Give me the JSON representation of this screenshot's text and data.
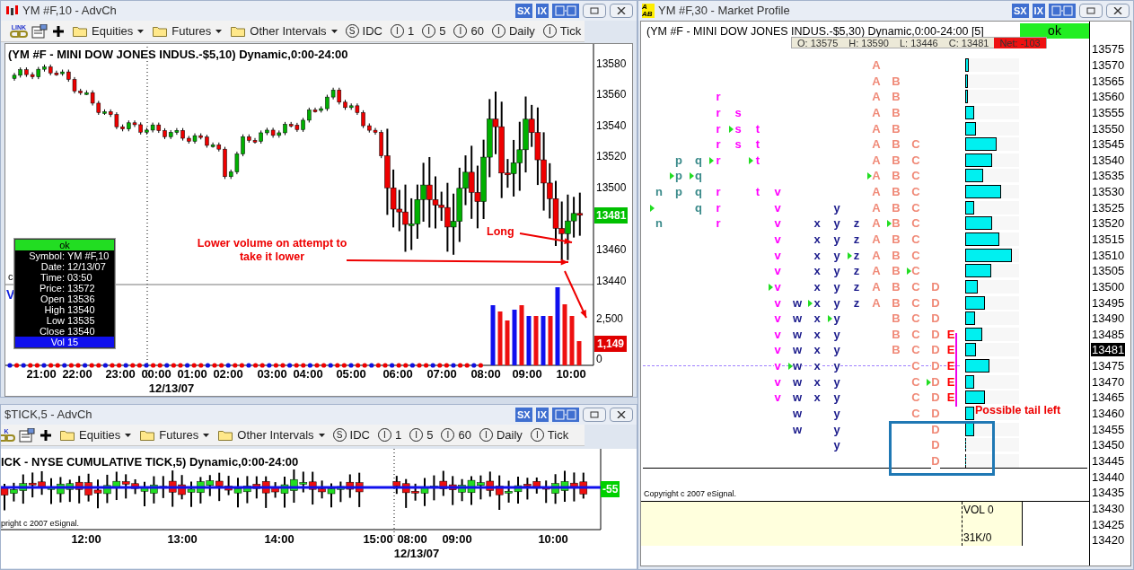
{
  "chart_window": {
    "title": "YM #F,10 - AdvCh",
    "title_buttons": [
      "SX",
      "IX"
    ],
    "toolbar": {
      "link_label": "LINK",
      "items": [
        {
          "kind": "folder",
          "label": "Equities"
        },
        {
          "kind": "folder",
          "label": "Futures"
        },
        {
          "kind": "folder",
          "label": "Other Intervals"
        },
        {
          "kind": "interval",
          "badge": "S",
          "label": "IDC"
        },
        {
          "kind": "interval",
          "badge": "I",
          "label": "1"
        },
        {
          "kind": "interval",
          "badge": "I",
          "label": "5"
        },
        {
          "kind": "interval",
          "badge": "I",
          "label": "60"
        },
        {
          "kind": "interval",
          "badge": "I",
          "label": "Daily"
        },
        {
          "kind": "interval",
          "badge": "I",
          "label": "Tick"
        }
      ]
    },
    "chart_title": "(YM #F - MINI DOW JONES INDUS.-$5,10) Dynamic,0:00-24:00",
    "price_labels": [
      "13580",
      "13560",
      "13540",
      "13520",
      "13500",
      "13460",
      "13440"
    ],
    "last_price": "13481",
    "volume_labels": [
      "2,500",
      "0"
    ],
    "last_volume": "1,149",
    "time_labels": [
      "21:00",
      "22:00",
      "23:00",
      "00:00",
      "01:00",
      "02:00",
      "03:00",
      "04:00",
      "05:00",
      "06:00",
      "07:00",
      "08:00",
      "09:00",
      "10:00"
    ],
    "date_label": "12/13/07",
    "edge_labels": [
      "c",
      "V"
    ],
    "data_window": {
      "status": "ok",
      "rows": [
        {
          "label": "Symbol:",
          "value": "YM #F,10",
          "selected": false
        },
        {
          "label": "Date:",
          "value": "12/13/07",
          "selected": false
        },
        {
          "label": "Time:",
          "value": "03:50",
          "selected": false
        },
        {
          "label": "Price:",
          "value": "13572",
          "selected": false
        },
        {
          "label": "Open",
          "value": "13536",
          "selected": false
        },
        {
          "label": "High",
          "value": "13540",
          "selected": false
        },
        {
          "label": "Low",
          "value": "13535",
          "selected": false
        },
        {
          "label": "Close",
          "value": "13540",
          "selected": false
        },
        {
          "label": "Vol",
          "value": "15",
          "selected": true
        }
      ]
    },
    "annotations": [
      "Lower volume on attempt to take it lower",
      "Long"
    ]
  },
  "tick_window": {
    "title": "$TICK,5 - AdvCh",
    "title_buttons": [
      "SX",
      "IX"
    ],
    "toolbar": {
      "link_label": "K",
      "items": [
        {
          "kind": "folder",
          "label": "Equities"
        },
        {
          "kind": "folder",
          "label": "Futures"
        },
        {
          "kind": "folder",
          "label": "Other Intervals"
        },
        {
          "kind": "interval",
          "badge": "S",
          "label": "IDC"
        },
        {
          "kind": "interval",
          "badge": "I",
          "label": "1"
        },
        {
          "kind": "interval",
          "badge": "I",
          "label": "5"
        },
        {
          "kind": "interval",
          "badge": "I",
          "label": "60"
        },
        {
          "kind": "interval",
          "badge": "I",
          "label": "Daily"
        },
        {
          "kind": "interval",
          "badge": "I",
          "label": "Tick"
        }
      ]
    },
    "chart_title": "ICK - NYSE CUMULATIVE TICK,5) Dynamic,0:00-24:00",
    "copyright": "pright c 2007 eSignal.",
    "last_value": "-55",
    "time_labels": [
      "12:00",
      "13:00",
      "14:00",
      "15:00",
      "08:00",
      "09:00",
      "10:00"
    ],
    "date_label": "12/13/07"
  },
  "profile_window": {
    "title": "YM #F,30 - Market Profile",
    "icon_text": [
      "A",
      "AB"
    ],
    "title_buttons": [
      "SX",
      "IX"
    ],
    "header": "(YM #F - MINI DOW JONES INDUS.-$5,30) Dynamic,0:00-24:00 [5]",
    "status": "ok",
    "ohlc": [
      "O: 13575",
      "H: 13590",
      "L: 13446",
      "C: 13481"
    ],
    "net": "Net: -103",
    "rows": [
      {
        "level": 0.07,
        "cells": [
          {
            "kind": "gap"
          },
          {
            "kind": "gap"
          },
          {
            "kind": "gap"
          },
          {
            "kind": "gap"
          },
          {
            "kind": "gap"
          },
          {
            "kind": "gap"
          },
          {
            "kind": "gap"
          },
          {
            "kind": "gap"
          },
          {
            "kind": "gap"
          },
          {
            "kind": "gap"
          },
          {
            "kind": "gap"
          },
          {
            "kind": "letter",
            "text": "A",
            "color": "#f08a78"
          }
        ]
      },
      {
        "level": 0.05,
        "cells": [
          {
            "kind": "gap"
          },
          {
            "kind": "gap"
          },
          {
            "kind": "gap"
          },
          {
            "kind": "gap"
          },
          {
            "kind": "gap"
          },
          {
            "kind": "gap"
          },
          {
            "kind": "gap"
          },
          {
            "kind": "gap"
          },
          {
            "kind": "gap"
          },
          {
            "kind": "gap"
          },
          {
            "kind": "gap"
          },
          {
            "kind": "letter",
            "text": "A",
            "color": "#f08a78"
          },
          {
            "kind": "letter",
            "text": "B",
            "color": "#f08a78"
          }
        ]
      },
      {
        "level": 0.05,
        "cells": [
          {
            "kind": "gap"
          },
          {
            "kind": "gap"
          },
          {
            "kind": "gap"
          },
          {
            "kind": "letter",
            "text": "r",
            "color": "#ff00ff"
          },
          {
            "kind": "gap"
          },
          {
            "kind": "gap"
          },
          {
            "kind": "gap"
          },
          {
            "kind": "gap"
          },
          {
            "kind": "gap"
          },
          {
            "kind": "gap"
          },
          {
            "kind": "gap"
          },
          {
            "kind": "letter",
            "text": "A",
            "color": "#f08a78"
          },
          {
            "kind": "letter",
            "text": "B",
            "color": "#f08a78"
          }
        ]
      },
      {
        "level": 0.17,
        "cells": [
          {
            "kind": "gap"
          },
          {
            "kind": "gap"
          },
          {
            "kind": "gap"
          },
          {
            "kind": "letter",
            "text": "r",
            "color": "#ff00ff"
          },
          {
            "kind": "letter",
            "text": "s",
            "color": "#ff00ff"
          },
          {
            "kind": "gap"
          },
          {
            "kind": "gap"
          },
          {
            "kind": "gap"
          },
          {
            "kind": "gap"
          },
          {
            "kind": "gap"
          },
          {
            "kind": "gap"
          },
          {
            "kind": "letter",
            "text": "A",
            "color": "#f08a78"
          },
          {
            "kind": "letter",
            "text": "B",
            "color": "#f08a78"
          }
        ]
      },
      {
        "level": 0.2,
        "cells": [
          {
            "kind": "gap"
          },
          {
            "kind": "gap"
          },
          {
            "kind": "gap"
          },
          {
            "kind": "letter",
            "text": "r",
            "color": "#ff00ff"
          },
          {
            "kind": "marked",
            "text": "s",
            "color": "#ff00ff"
          },
          {
            "kind": "letter",
            "text": "t",
            "color": "#ff00ff"
          },
          {
            "kind": "gap"
          },
          {
            "kind": "gap"
          },
          {
            "kind": "gap"
          },
          {
            "kind": "gap"
          },
          {
            "kind": "gap"
          },
          {
            "kind": "letter",
            "text": "A",
            "color": "#f08a78"
          },
          {
            "kind": "letter",
            "text": "B",
            "color": "#f08a78"
          }
        ]
      },
      {
        "level": 0.58,
        "cells": [
          {
            "kind": "gap"
          },
          {
            "kind": "gap"
          },
          {
            "kind": "gap"
          },
          {
            "kind": "letter",
            "text": "r",
            "color": "#ff00ff"
          },
          {
            "kind": "letter",
            "text": "s",
            "color": "#ff00ff"
          },
          {
            "kind": "letter",
            "text": "t",
            "color": "#ff00ff"
          },
          {
            "kind": "gap"
          },
          {
            "kind": "gap"
          },
          {
            "kind": "gap"
          },
          {
            "kind": "gap"
          },
          {
            "kind": "gap"
          },
          {
            "kind": "letter",
            "text": "A",
            "color": "#f08a78"
          },
          {
            "kind": "letter",
            "text": "B",
            "color": "#f08a78"
          },
          {
            "kind": "letter",
            "text": "C",
            "color": "#f08a78"
          }
        ]
      },
      {
        "level": 0.5,
        "cells": [
          {
            "kind": "gap"
          },
          {
            "kind": "letter",
            "text": "p",
            "color": "#3a8a8a"
          },
          {
            "kind": "letter",
            "text": "q",
            "color": "#3a8a8a"
          },
          {
            "kind": "marked",
            "text": "r",
            "color": "#ff00ff"
          },
          {
            "kind": "gap"
          },
          {
            "kind": "marked",
            "text": "t",
            "color": "#ff00ff"
          },
          {
            "kind": "gap"
          },
          {
            "kind": "gap"
          },
          {
            "kind": "gap"
          },
          {
            "kind": "gap"
          },
          {
            "kind": "gap"
          },
          {
            "kind": "letter",
            "text": "A",
            "color": "#f08a78"
          },
          {
            "kind": "letter",
            "text": "B",
            "color": "#f08a78"
          },
          {
            "kind": "letter",
            "text": "C",
            "color": "#f08a78"
          }
        ]
      },
      {
        "level": 0.33,
        "cells": [
          {
            "kind": "gap"
          },
          {
            "kind": "marked",
            "text": "p",
            "color": "#3a8a8a"
          },
          {
            "kind": "marked",
            "text": "q",
            "color": "#3a8a8a"
          },
          {
            "kind": "gap"
          },
          {
            "kind": "gap"
          },
          {
            "kind": "gap"
          },
          {
            "kind": "gap"
          },
          {
            "kind": "gap"
          },
          {
            "kind": "gap"
          },
          {
            "kind": "gap"
          },
          {
            "kind": "gap"
          },
          {
            "kind": "marked",
            "text": "A",
            "color": "#f08a78"
          },
          {
            "kind": "letter",
            "text": "B",
            "color": "#f08a78"
          },
          {
            "kind": "letter",
            "text": "C",
            "color": "#f08a78"
          }
        ]
      },
      {
        "level": 0.67,
        "cells": [
          {
            "kind": "letter",
            "text": "n",
            "color": "#3a8a8a"
          },
          {
            "kind": "letter",
            "text": "p",
            "color": "#3a8a8a"
          },
          {
            "kind": "letter",
            "text": "q",
            "color": "#3a8a8a"
          },
          {
            "kind": "letter",
            "text": "r",
            "color": "#ff00ff"
          },
          {
            "kind": "gap"
          },
          {
            "kind": "letter",
            "text": "t",
            "color": "#ff00ff"
          },
          {
            "kind": "letter",
            "text": "v",
            "color": "#ff00ff"
          },
          {
            "kind": "gap"
          },
          {
            "kind": "gap"
          },
          {
            "kind": "gap"
          },
          {
            "kind": "gap"
          },
          {
            "kind": "letter",
            "text": "A",
            "color": "#f08a78"
          },
          {
            "kind": "letter",
            "text": "B",
            "color": "#f08a78"
          },
          {
            "kind": "letter",
            "text": "C",
            "color": "#f08a78"
          }
        ]
      },
      {
        "level": 0.17,
        "cells": [
          {
            "kind": "marker"
          },
          {
            "kind": "gap"
          },
          {
            "kind": "letter",
            "text": "q",
            "color": "#3a8a8a"
          },
          {
            "kind": "letter",
            "text": "r",
            "color": "#ff00ff"
          },
          {
            "kind": "gap"
          },
          {
            "kind": "gap"
          },
          {
            "kind": "letter",
            "text": "v",
            "color": "#ff00ff"
          },
          {
            "kind": "gap"
          },
          {
            "kind": "gap"
          },
          {
            "kind": "letter",
            "text": "y",
            "color": "#1c1c8c"
          },
          {
            "kind": "gap"
          },
          {
            "kind": "letter",
            "text": "A",
            "color": "#f08a78"
          },
          {
            "kind": "letter",
            "text": "B",
            "color": "#f08a78"
          },
          {
            "kind": "letter",
            "text": "C",
            "color": "#f08a78"
          }
        ]
      },
      {
        "level": 0.5,
        "cells": [
          {
            "kind": "letter",
            "text": "n",
            "color": "#3a8a8a"
          },
          {
            "kind": "gap"
          },
          {
            "kind": "gap"
          },
          {
            "kind": "letter",
            "text": "r",
            "color": "#ff00ff"
          },
          {
            "kind": "gap"
          },
          {
            "kind": "gap"
          },
          {
            "kind": "letter",
            "text": "v",
            "color": "#ff00ff"
          },
          {
            "kind": "gap"
          },
          {
            "kind": "letter",
            "text": "x",
            "color": "#1c1c8c"
          },
          {
            "kind": "letter",
            "text": "y",
            "color": "#1c1c8c"
          },
          {
            "kind": "letter",
            "text": "z",
            "color": "#1c1c8c"
          },
          {
            "kind": "letter",
            "text": "A",
            "color": "#f08a78"
          },
          {
            "kind": "marked",
            "text": "B",
            "color": "#f08a78"
          },
          {
            "kind": "letter",
            "text": "C",
            "color": "#f08a78"
          }
        ]
      },
      {
        "level": 0.63,
        "cells": [
          {
            "kind": "gap"
          },
          {
            "kind": "gap"
          },
          {
            "kind": "gap"
          },
          {
            "kind": "gap"
          },
          {
            "kind": "gap"
          },
          {
            "kind": "gap"
          },
          {
            "kind": "letter",
            "text": "v",
            "color": "#ff00ff"
          },
          {
            "kind": "gap"
          },
          {
            "kind": "letter",
            "text": "x",
            "color": "#1c1c8c"
          },
          {
            "kind": "letter",
            "text": "y",
            "color": "#1c1c8c"
          },
          {
            "kind": "letter",
            "text": "z",
            "color": "#1c1c8c"
          },
          {
            "kind": "letter",
            "text": "A",
            "color": "#f08a78"
          },
          {
            "kind": "letter",
            "text": "B",
            "color": "#f08a78"
          },
          {
            "kind": "letter",
            "text": "C",
            "color": "#f08a78"
          }
        ]
      },
      {
        "level": 0.87,
        "cells": [
          {
            "kind": "gap"
          },
          {
            "kind": "gap"
          },
          {
            "kind": "gap"
          },
          {
            "kind": "gap"
          },
          {
            "kind": "gap"
          },
          {
            "kind": "gap"
          },
          {
            "kind": "letter",
            "text": "v",
            "color": "#ff00ff"
          },
          {
            "kind": "gap"
          },
          {
            "kind": "letter",
            "text": "x",
            "color": "#1c1c8c"
          },
          {
            "kind": "letter",
            "text": "y",
            "color": "#1c1c8c"
          },
          {
            "kind": "marked",
            "text": "z",
            "color": "#1c1c8c"
          },
          {
            "kind": "letter",
            "text": "A",
            "color": "#f08a78"
          },
          {
            "kind": "letter",
            "text": "B",
            "color": "#f08a78"
          },
          {
            "kind": "letter",
            "text": "C",
            "color": "#f08a78"
          }
        ]
      },
      {
        "level": 0.48,
        "cells": [
          {
            "kind": "gap"
          },
          {
            "kind": "gap"
          },
          {
            "kind": "gap"
          },
          {
            "kind": "gap"
          },
          {
            "kind": "gap"
          },
          {
            "kind": "gap"
          },
          {
            "kind": "letter",
            "text": "v",
            "color": "#ff00ff"
          },
          {
            "kind": "gap"
          },
          {
            "kind": "letter",
            "text": "x",
            "color": "#1c1c8c"
          },
          {
            "kind": "letter",
            "text": "y",
            "color": "#1c1c8c"
          },
          {
            "kind": "letter",
            "text": "z",
            "color": "#1c1c8c"
          },
          {
            "kind": "letter",
            "text": "A",
            "color": "#f08a78"
          },
          {
            "kind": "letter",
            "text": "B",
            "color": "#f08a78"
          },
          {
            "kind": "marked",
            "text": "C",
            "color": "#f08a78"
          }
        ]
      },
      {
        "level": 0.23,
        "cells": [
          {
            "kind": "gap"
          },
          {
            "kind": "gap"
          },
          {
            "kind": "gap"
          },
          {
            "kind": "gap"
          },
          {
            "kind": "gap"
          },
          {
            "kind": "gap"
          },
          {
            "kind": "marked",
            "text": "v",
            "color": "#ff00ff"
          },
          {
            "kind": "gap"
          },
          {
            "kind": "letter",
            "text": "x",
            "color": "#1c1c8c"
          },
          {
            "kind": "letter",
            "text": "y",
            "color": "#1c1c8c"
          },
          {
            "kind": "letter",
            "text": "z",
            "color": "#1c1c8c"
          },
          {
            "kind": "letter",
            "text": "A",
            "color": "#f08a78"
          },
          {
            "kind": "letter",
            "text": "B",
            "color": "#f08a78"
          },
          {
            "kind": "letter",
            "text": "C",
            "color": "#f08a78"
          },
          {
            "kind": "letter",
            "text": "D",
            "color": "#f08a78"
          }
        ]
      },
      {
        "level": 0.37,
        "cells": [
          {
            "kind": "gap"
          },
          {
            "kind": "gap"
          },
          {
            "kind": "gap"
          },
          {
            "kind": "gap"
          },
          {
            "kind": "gap"
          },
          {
            "kind": "gap"
          },
          {
            "kind": "letter",
            "text": "v",
            "color": "#ff00ff"
          },
          {
            "kind": "letter",
            "text": "w",
            "color": "#1c1c8c"
          },
          {
            "kind": "marked",
            "text": "x",
            "color": "#1c1c8c"
          },
          {
            "kind": "letter",
            "text": "y",
            "color": "#1c1c8c"
          },
          {
            "kind": "letter",
            "text": "z",
            "color": "#1c1c8c"
          },
          {
            "kind": "letter",
            "text": "A",
            "color": "#f08a78"
          },
          {
            "kind": "letter",
            "text": "B",
            "color": "#f08a78"
          },
          {
            "kind": "letter",
            "text": "C",
            "color": "#f08a78"
          },
          {
            "kind": "letter",
            "text": "D",
            "color": "#f08a78"
          }
        ]
      },
      {
        "level": 0.18,
        "cells": [
          {
            "kind": "gap"
          },
          {
            "kind": "gap"
          },
          {
            "kind": "gap"
          },
          {
            "kind": "gap"
          },
          {
            "kind": "gap"
          },
          {
            "kind": "gap"
          },
          {
            "kind": "letter",
            "text": "v",
            "color": "#ff00ff"
          },
          {
            "kind": "letter",
            "text": "w",
            "color": "#1c1c8c"
          },
          {
            "kind": "letter",
            "text": "x",
            "color": "#1c1c8c"
          },
          {
            "kind": "marked",
            "text": "y",
            "color": "#1c1c8c"
          },
          {
            "kind": "gap"
          },
          {
            "kind": "gap"
          },
          {
            "kind": "letter",
            "text": "B",
            "color": "#f08a78"
          },
          {
            "kind": "letter",
            "text": "C",
            "color": "#f08a78"
          },
          {
            "kind": "letter",
            "text": "D",
            "color": "#f08a78"
          }
        ]
      },
      {
        "level": 0.32,
        "cells": [
          {
            "kind": "gap"
          },
          {
            "kind": "gap"
          },
          {
            "kind": "gap"
          },
          {
            "kind": "gap"
          },
          {
            "kind": "gap"
          },
          {
            "kind": "gap"
          },
          {
            "kind": "letter",
            "text": "v",
            "color": "#ff00ff"
          },
          {
            "kind": "letter",
            "text": "w",
            "color": "#1c1c8c"
          },
          {
            "kind": "letter",
            "text": "x",
            "color": "#1c1c8c"
          },
          {
            "kind": "letter",
            "text": "y",
            "color": "#1c1c8c"
          },
          {
            "kind": "gap"
          },
          {
            "kind": "gap"
          },
          {
            "kind": "letter",
            "text": "B",
            "color": "#f08a78"
          },
          {
            "kind": "letter",
            "text": "C",
            "color": "#f08a78"
          },
          {
            "kind": "letter",
            "text": "D",
            "color": "#f08a78"
          },
          {
            "kind": "letter",
            "text": "E",
            "color": "#ff0000"
          }
        ]
      },
      {
        "level": 0.2,
        "cells": [
          {
            "kind": "gap"
          },
          {
            "kind": "gap"
          },
          {
            "kind": "gap"
          },
          {
            "kind": "gap"
          },
          {
            "kind": "gap"
          },
          {
            "kind": "gap"
          },
          {
            "kind": "letter",
            "text": "v",
            "color": "#ff00ff"
          },
          {
            "kind": "letter",
            "text": "w",
            "color": "#1c1c8c"
          },
          {
            "kind": "letter",
            "text": "x",
            "color": "#1c1c8c"
          },
          {
            "kind": "letter",
            "text": "y",
            "color": "#1c1c8c"
          },
          {
            "kind": "gap"
          },
          {
            "kind": "gap"
          },
          {
            "kind": "letter",
            "text": "B",
            "color": "#f08a78"
          },
          {
            "kind": "letter",
            "text": "C",
            "color": "#f08a78"
          },
          {
            "kind": "letter",
            "text": "D",
            "color": "#f08a78"
          },
          {
            "kind": "letter",
            "text": "E",
            "color": "#ff0000"
          }
        ]
      },
      {
        "level": 0.45,
        "cells": [
          {
            "kind": "gap"
          },
          {
            "kind": "gap"
          },
          {
            "kind": "gap"
          },
          {
            "kind": "gap"
          },
          {
            "kind": "gap"
          },
          {
            "kind": "gap"
          },
          {
            "kind": "letter",
            "text": "v",
            "color": "#ff00ff"
          },
          {
            "kind": "marked",
            "text": "w",
            "color": "#1c1c8c"
          },
          {
            "kind": "letter",
            "text": "x",
            "color": "#1c1c8c"
          },
          {
            "kind": "letter",
            "text": "y",
            "color": "#1c1c8c"
          },
          {
            "kind": "gap"
          },
          {
            "kind": "gap"
          },
          {
            "kind": "gap"
          },
          {
            "kind": "letter",
            "text": "C",
            "color": "#f08a78"
          },
          {
            "kind": "letter",
            "text": "D",
            "color": "#f08a78"
          },
          {
            "kind": "letter",
            "text": "E",
            "color": "#ff0000"
          }
        ]
      },
      {
        "level": 0.17,
        "cells": [
          {
            "kind": "gap"
          },
          {
            "kind": "gap"
          },
          {
            "kind": "gap"
          },
          {
            "kind": "gap"
          },
          {
            "kind": "gap"
          },
          {
            "kind": "gap"
          },
          {
            "kind": "letter",
            "text": "v",
            "color": "#ff00ff"
          },
          {
            "kind": "letter",
            "text": "w",
            "color": "#1c1c8c"
          },
          {
            "kind": "letter",
            "text": "x",
            "color": "#1c1c8c"
          },
          {
            "kind": "letter",
            "text": "y",
            "color": "#1c1c8c"
          },
          {
            "kind": "gap"
          },
          {
            "kind": "gap"
          },
          {
            "kind": "gap"
          },
          {
            "kind": "letter",
            "text": "C",
            "color": "#f08a78"
          },
          {
            "kind": "marked",
            "text": "D",
            "color": "#f08a78"
          },
          {
            "kind": "letter",
            "text": "E",
            "color": "#ff0000"
          }
        ]
      },
      {
        "level": 0.37,
        "cells": [
          {
            "kind": "gap"
          },
          {
            "kind": "gap"
          },
          {
            "kind": "gap"
          },
          {
            "kind": "gap"
          },
          {
            "kind": "gap"
          },
          {
            "kind": "gap"
          },
          {
            "kind": "letter",
            "text": "v",
            "color": "#ff00ff"
          },
          {
            "kind": "letter",
            "text": "w",
            "color": "#1c1c8c"
          },
          {
            "kind": "letter",
            "text": "x",
            "color": "#1c1c8c"
          },
          {
            "kind": "letter",
            "text": "y",
            "color": "#1c1c8c"
          },
          {
            "kind": "gap"
          },
          {
            "kind": "gap"
          },
          {
            "kind": "gap"
          },
          {
            "kind": "letter",
            "text": "C",
            "color": "#f08a78"
          },
          {
            "kind": "letter",
            "text": "D",
            "color": "#f08a78"
          },
          {
            "kind": "letter",
            "text": "E",
            "color": "#ff0000"
          }
        ]
      },
      {
        "level": 0.17,
        "cells": [
          {
            "kind": "gap"
          },
          {
            "kind": "gap"
          },
          {
            "kind": "gap"
          },
          {
            "kind": "gap"
          },
          {
            "kind": "gap"
          },
          {
            "kind": "gap"
          },
          {
            "kind": "gap"
          },
          {
            "kind": "letter",
            "text": "w",
            "color": "#1c1c8c"
          },
          {
            "kind": "gap"
          },
          {
            "kind": "letter",
            "text": "y",
            "color": "#1c1c8c"
          },
          {
            "kind": "gap"
          },
          {
            "kind": "gap"
          },
          {
            "kind": "gap"
          },
          {
            "kind": "letter",
            "text": "C",
            "color": "#f08a78"
          },
          {
            "kind": "letter",
            "text": "D",
            "color": "#f08a78"
          }
        ]
      },
      {
        "level": 0.17,
        "cells": [
          {
            "kind": "gap"
          },
          {
            "kind": "gap"
          },
          {
            "kind": "gap"
          },
          {
            "kind": "gap"
          },
          {
            "kind": "gap"
          },
          {
            "kind": "gap"
          },
          {
            "kind": "gap"
          },
          {
            "kind": "letter",
            "text": "w",
            "color": "#1c1c8c"
          },
          {
            "kind": "gap"
          },
          {
            "kind": "letter",
            "text": "y",
            "color": "#1c1c8c"
          },
          {
            "kind": "gap"
          },
          {
            "kind": "gap"
          },
          {
            "kind": "gap"
          },
          {
            "kind": "gap"
          },
          {
            "kind": "letter",
            "text": "D",
            "color": "#f08a78"
          }
        ]
      },
      {
        "level": 0,
        "cells": [
          {
            "kind": "gap"
          },
          {
            "kind": "gap"
          },
          {
            "kind": "gap"
          },
          {
            "kind": "gap"
          },
          {
            "kind": "gap"
          },
          {
            "kind": "gap"
          },
          {
            "kind": "gap"
          },
          {
            "kind": "gap"
          },
          {
            "kind": "gap"
          },
          {
            "kind": "letter",
            "text": "y",
            "color": "#1c1c8c"
          },
          {
            "kind": "gap"
          },
          {
            "kind": "gap"
          },
          {
            "kind": "gap"
          },
          {
            "kind": "gap"
          },
          {
            "kind": "letter",
            "text": "D",
            "color": "#f08a78"
          }
        ]
      },
      {
        "level": 0,
        "cells": [
          {
            "kind": "gap"
          },
          {
            "kind": "gap"
          },
          {
            "kind": "gap"
          },
          {
            "kind": "gap"
          },
          {
            "kind": "gap"
          },
          {
            "kind": "gap"
          },
          {
            "kind": "gap"
          },
          {
            "kind": "gap"
          },
          {
            "kind": "gap"
          },
          {
            "kind": "gap"
          },
          {
            "kind": "gap"
          },
          {
            "kind": "gap"
          },
          {
            "kind": "gap"
          },
          {
            "kind": "gap"
          },
          {
            "kind": "letter",
            "text": "D",
            "color": "#f08a78"
          }
        ]
      }
    ],
    "price_axis": [
      {
        "label": "13575",
        "current": false
      },
      {
        "label": "13570",
        "current": false
      },
      {
        "label": "13565",
        "current": false
      },
      {
        "label": "13560",
        "current": false
      },
      {
        "label": "13555",
        "current": false
      },
      {
        "label": "13550",
        "current": false
      },
      {
        "label": "13545",
        "current": false
      },
      {
        "label": "13540",
        "current": false
      },
      {
        "label": "13535",
        "current": false
      },
      {
        "label": "13530",
        "current": false
      },
      {
        "label": "13525",
        "current": false
      },
      {
        "label": "13520",
        "current": false
      },
      {
        "label": "13515",
        "current": false
      },
      {
        "label": "13510",
        "current": false
      },
      {
        "label": "13505",
        "current": false
      },
      {
        "label": "13500",
        "current": false
      },
      {
        "label": "13495",
        "current": false
      },
      {
        "label": "13490",
        "current": false
      },
      {
        "label": "13485",
        "current": false
      },
      {
        "label": "13481",
        "current": true
      },
      {
        "label": "13475",
        "current": false
      },
      {
        "label": "13470",
        "current": false
      },
      {
        "label": "13465",
        "current": false
      },
      {
        "label": "13460",
        "current": false
      },
      {
        "label": "13455",
        "current": false
      },
      {
        "label": "13450",
        "current": false
      },
      {
        "label": "13445",
        "current": false
      },
      {
        "label": "13440",
        "current": false
      },
      {
        "label": "13435",
        "current": false
      },
      {
        "label": "13430",
        "current": false
      },
      {
        "label": "13425",
        "current": false
      },
      {
        "label": "13420",
        "current": false
      }
    ],
    "annotation": "Possible tail left",
    "copyright": "Copyright c 2007 eSignal.",
    "summary": [
      "VOL 0",
      "31K/0"
    ]
  }
}
